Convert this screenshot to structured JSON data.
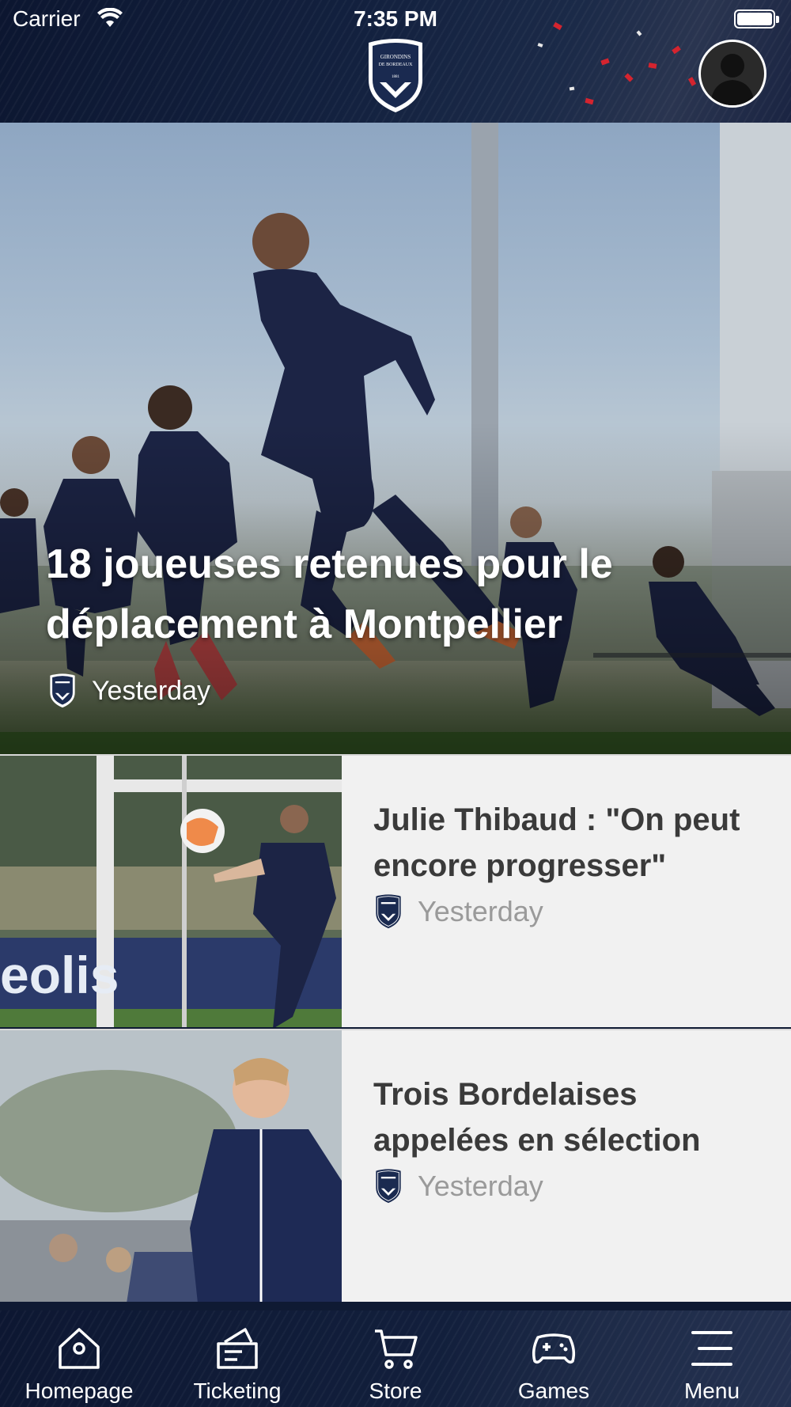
{
  "status_bar": {
    "carrier": "Carrier",
    "time": "7:35 PM"
  },
  "header": {
    "crest_text": [
      "GIRONDINS",
      "DE BORDEAUX",
      "1881"
    ],
    "brand_navy": "#0f1a33",
    "accent_red": "#d4242f"
  },
  "hero": {
    "title": "18 joueuses retenues pour le déplacement à Montpellier",
    "date": "Yesterday"
  },
  "articles": [
    {
      "title": "Julie Thibaud : \"On peut encore progresser\"",
      "date": "Yesterday"
    },
    {
      "title": "Trois Bordelaises appelées en sélection",
      "date": "Yesterday"
    }
  ],
  "tabs": [
    {
      "label": "Homepage",
      "icon": "home-icon"
    },
    {
      "label": "Ticketing",
      "icon": "ticket-icon"
    },
    {
      "label": "Store",
      "icon": "cart-icon"
    },
    {
      "label": "Games",
      "icon": "gamepad-icon"
    },
    {
      "label": "Menu",
      "icon": "menu-icon"
    }
  ]
}
